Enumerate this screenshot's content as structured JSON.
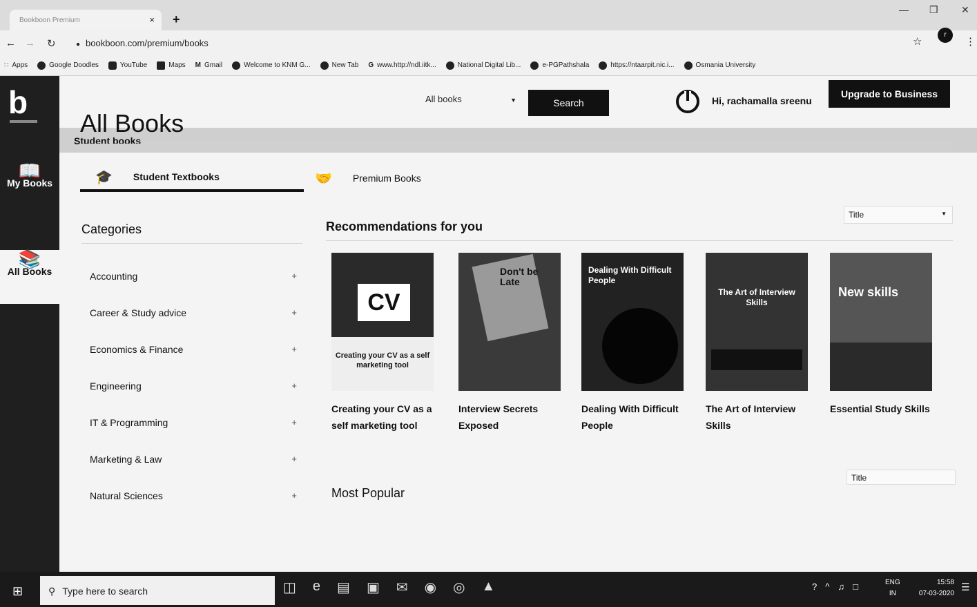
{
  "browser": {
    "tab_title": "Bookboon Premium",
    "tab_close": "×",
    "new_tab": "+",
    "url": "bookboon.com/premium/books",
    "profile_initial": "r",
    "bookmarks": [
      {
        "label": "Apps",
        "icon": "apps-grid-icon"
      },
      {
        "label": "Google Doodles",
        "icon": "globe-icon"
      },
      {
        "label": "YouTube",
        "icon": "youtube-icon"
      },
      {
        "label": "Maps",
        "icon": "maps-icon"
      },
      {
        "label": "Gmail",
        "icon": "gmail-icon"
      },
      {
        "label": "Welcome to KNM G...",
        "icon": "globe-icon"
      },
      {
        "label": "New Tab",
        "icon": "globe-icon"
      },
      {
        "label": "www.http://ndl.iitk...",
        "icon": "google-icon"
      },
      {
        "label": "National Digital Lib...",
        "icon": "globe-icon"
      },
      {
        "label": "e-PGPathshala",
        "icon": "globe-icon"
      },
      {
        "label": "https://ntaarpit.nic.i...",
        "icon": "globe-icon"
      },
      {
        "label": "Osmania University",
        "icon": "globe-icon"
      }
    ]
  },
  "sidebar": {
    "logo_letter": "b",
    "items": [
      {
        "label": "My Books",
        "icon": "open-book-icon"
      },
      {
        "label": "All Books",
        "icon": "books-shelf-icon"
      }
    ]
  },
  "header": {
    "search_scope": "All books",
    "search_button": "Search",
    "greeting": "Hi, rachamalla sreenu",
    "upgrade_button": "Upgrade to Business"
  },
  "breadcrumb": "Student books",
  "page_title": "All Books",
  "tabs": [
    {
      "label": "Student Textbooks",
      "icon": "graduation-cap-icon",
      "active": true
    },
    {
      "label": "Premium Books",
      "icon": "handshake-icon",
      "active": false
    }
  ],
  "categories": {
    "title": "Categories",
    "items": [
      {
        "label": "Accounting"
      },
      {
        "label": "Career & Study advice"
      },
      {
        "label": "Economics & Finance"
      },
      {
        "label": "Engineering"
      },
      {
        "label": "IT & Programming"
      },
      {
        "label": "Marketing & Law"
      },
      {
        "label": "Natural Sciences"
      }
    ],
    "expand_symbol": "+"
  },
  "recommendations": {
    "title": "Recommendations for you",
    "sort_value": "Title",
    "books": [
      {
        "title": "Creating your CV as a self marketing tool",
        "cover_top": "",
        "cover_big": "CV",
        "cover_lower": "Creating your CV as a self marketing tool"
      },
      {
        "title": "Interview Secrets Exposed",
        "cover_top": "Don't be Late",
        "cover_big": "",
        "cover_lower": ""
      },
      {
        "title": "Dealing With Difficult People",
        "cover_top": "Dealing With Difficult People",
        "cover_big": "",
        "cover_lower": ""
      },
      {
        "title": "The Art of Interview Skills",
        "cover_top": "The Art of Interview Skills",
        "cover_big": "",
        "cover_lower": ""
      },
      {
        "title": "Essential Study Skills",
        "cover_top": "New skills",
        "cover_big": "",
        "cover_lower": ""
      }
    ]
  },
  "most_popular": {
    "title": "Most Popular",
    "sort_value": "Title"
  },
  "taskbar": {
    "search_placeholder": "Type here to search",
    "lang": "ENG",
    "region": "IN",
    "time": "15:58",
    "date": "07-03-2020"
  }
}
